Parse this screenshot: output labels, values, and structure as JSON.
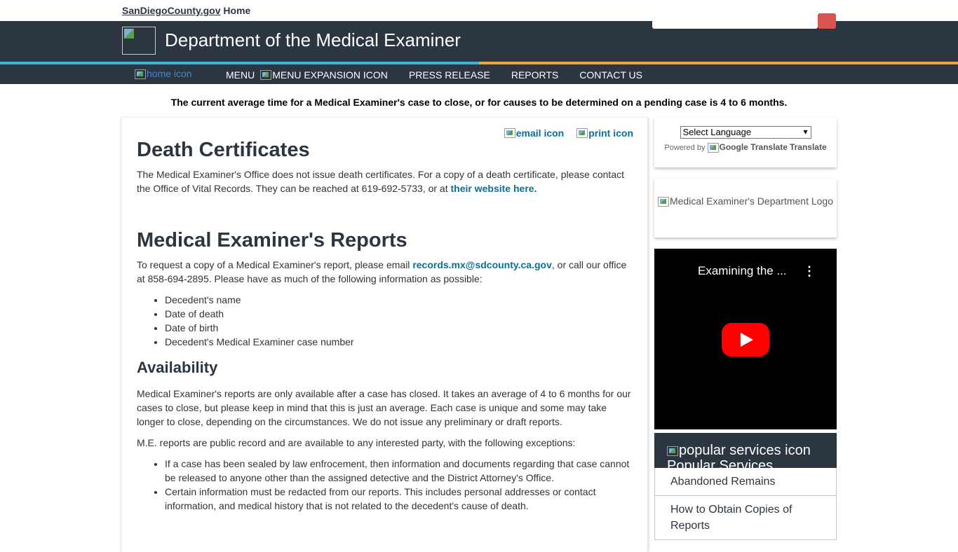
{
  "utility": {
    "site_link": "SanDiegoCounty.gov",
    "home_label": "Home",
    "search_placeholder": ""
  },
  "header": {
    "title": "Department of the Medical Examiner"
  },
  "nav": {
    "home_icon_alt": "home icon",
    "menu_label": "MENU",
    "menu_expansion_alt": "MENU EXPANSION ICON",
    "items": [
      "PRESS RELEASE",
      "REPORTS",
      "CONTACT US"
    ]
  },
  "notice": "The current average time for a Medical Examiner's case to close, or for causes to be determined on a pending case is 4 to 6 months.",
  "tools": {
    "email_alt": "email icon",
    "print_alt": "print icon"
  },
  "content": {
    "death_certificates": {
      "heading": "Death Certificates",
      "text": "The Medical Examiner's Office does not issue death certificates. For a copy of a death certificate, please contact the Office of Vital Records. They can be reached at 619-692-5733, or at ",
      "link": "their website here."
    },
    "reports": {
      "heading": "Medical Examiner's Reports",
      "text_before": "To request a copy of a Medical Examiner's report, please email ",
      "email": "records.mx@sdcounty.ca.gov",
      "text_after": ", or call our office at 858-694-2895. Please have as much of the following information as possible:",
      "items": [
        "Decedent's name",
        "Date of death",
        "Date of birth",
        "Decedent's Medical Examiner case number"
      ]
    },
    "availability": {
      "heading": "Availability",
      "paragraph1": "Medical Examiner's reports are only available after a case has closed. It takes an average of 4 to 6 months for our cases to close, but please keep in mind that this is just an average. Each case is unique and some may take longer to close, depending on the circumstances. We do not issue any preliminary or draft reports.",
      "paragraph2": "M.E. reports are public record and are available to any interested party, with the following exceptions:",
      "exceptions": [
        "If a case has been sealed by law enfrocement, then information and documents regarding that case cannot be released to anyone other than the assigned detective and the District Attorney's Office.",
        "Certain information must be redacted from our reports. This includes personal addresses or contact information, and medical history that is not related to the decedent's cause of death."
      ]
    }
  },
  "sidebar": {
    "translate": {
      "select_value": "Select Language",
      "powered_by": "Powered by",
      "google_alt": "Google Translate",
      "translate_label": "Translate"
    },
    "logo_alt": "Medical Examiner's Department Logo",
    "video": {
      "title": "Examining the ...",
      "menu_glyph": "⋮"
    },
    "popular": {
      "icon_alt": "popular services icon",
      "heading": "Popular Services",
      "items": [
        "Abandoned Remains",
        "How to Obtain Copies of Reports"
      ]
    }
  },
  "colors": {
    "header_bg": "#2b3640",
    "accent_blue": "#3eb1d8",
    "accent_gold": "#e8a93a",
    "link": "#0b6f92",
    "search_button": "#d9534f"
  }
}
